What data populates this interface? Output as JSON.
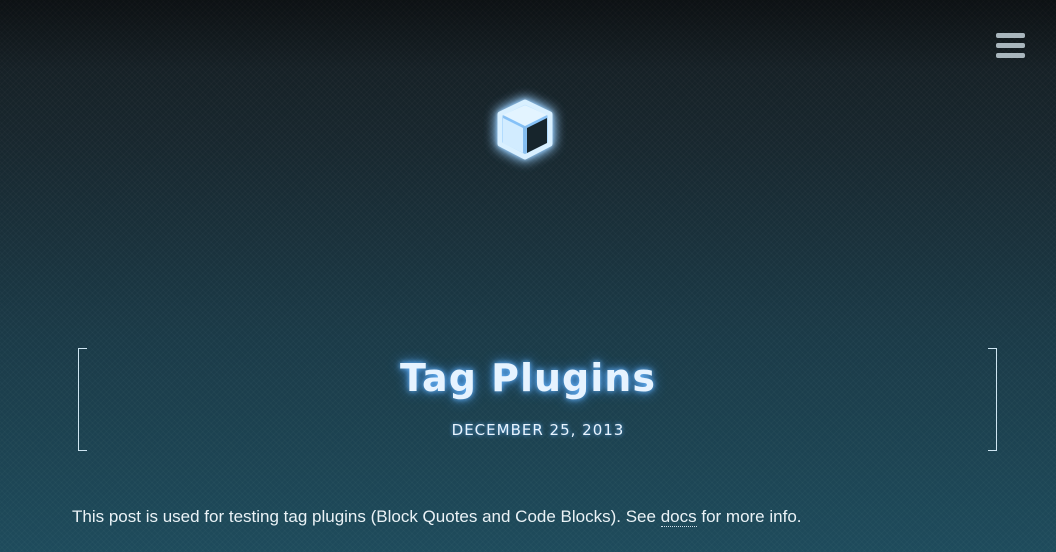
{
  "header": {
    "menu_icon": "hamburger-menu-icon",
    "logo_icon": "cube-icon"
  },
  "post": {
    "title": "Tag Plugins",
    "date": "DECEMBER 25, 2013",
    "intro_before": "This post is used for testing tag plugins (Block Quotes and Code Blocks). See ",
    "intro_link": "docs",
    "intro_after": " for more info."
  },
  "colors": {
    "background_top": "#141b1f",
    "background_bottom": "#1e4b5c",
    "glow": "#6bb8ff",
    "text": "#eaf2f6"
  }
}
